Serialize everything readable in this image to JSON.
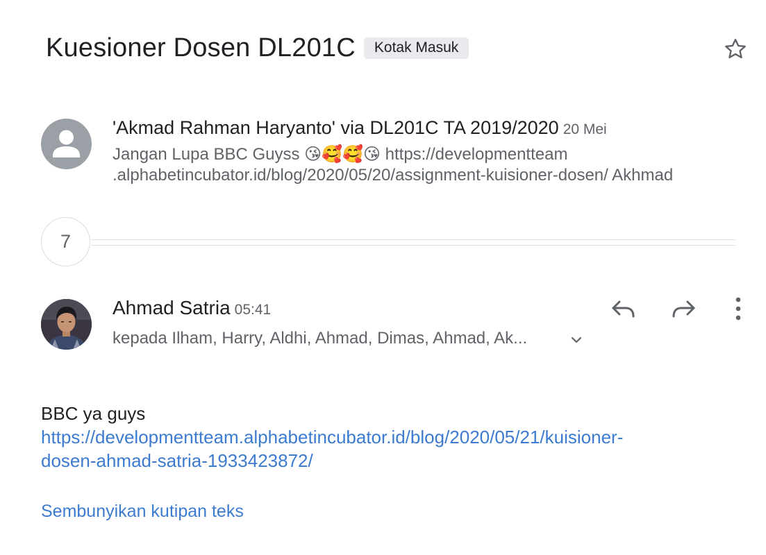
{
  "thread": {
    "subject": "Kuesioner Dosen DL201C",
    "label": "Kotak Masuk"
  },
  "message1": {
    "sender": "'Akmad Rahman Haryanto' via DL201C TA 2019/2020",
    "date": "20 Mei",
    "snippet": "Jangan Lupa BBC Guyss 😘🥰🥰😘 https://developmentteam\n.alphabetincubator.id/blog/2020/05/20/assignment-kuisioner-dosen/ Akhmad"
  },
  "collapsed": {
    "count": "7"
  },
  "message2": {
    "sender": "Ahmad Satria",
    "time": "05:41",
    "recipients": "kepada Ilham, Harry, Aldhi, Ahmad, Dimas, Ahmad, Ak...",
    "body_text": "BBC ya guys",
    "body_link": "https://developmentteam.alphabetincubator.id/blog/2020/05/21/kuisioner-\ndosen-ahmad-satria-1933423872/",
    "hide_quote": "Sembunyikan kutipan teks"
  },
  "icons": {
    "star": "star-outline-icon",
    "reply": "reply-icon",
    "forward": "forward-icon",
    "more": "more-vert-icon",
    "expand": "chevron-down-icon",
    "avatar_placeholder": "person-icon"
  },
  "colors": {
    "link": "#3d7bd0",
    "secondary_text": "#5f6368",
    "chip_bg": "#e8eaed",
    "avatar_gray": "#9aa0a6"
  }
}
